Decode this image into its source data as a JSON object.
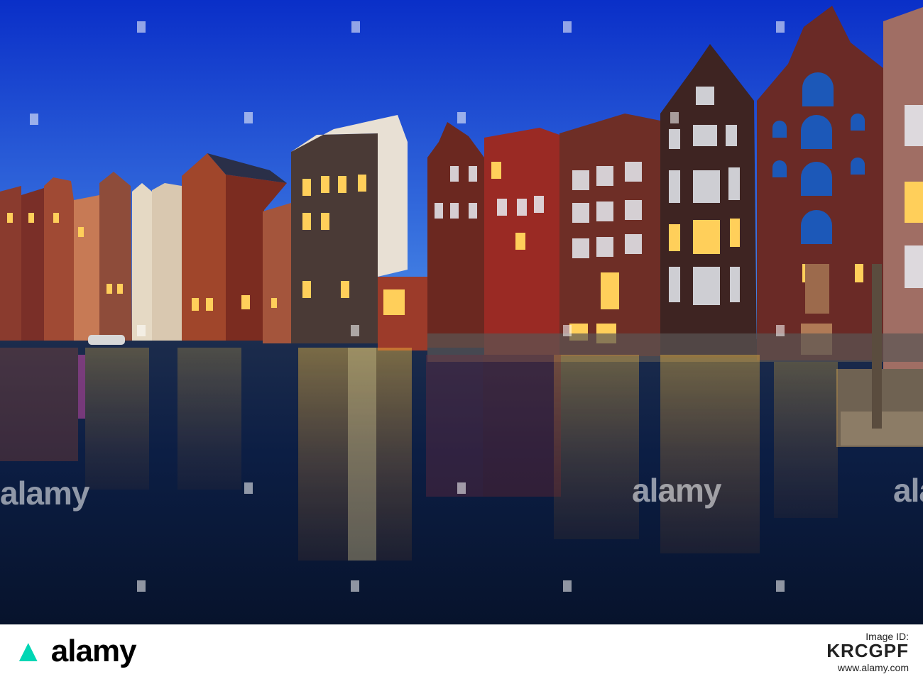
{
  "watermark": {
    "text": "alamy"
  },
  "footer": {
    "logo_text": "alamy",
    "image_id_label": "Image ID:",
    "image_id": "KRCGPF",
    "site": "www.alamy.com"
  },
  "colors": {
    "sky_top": "#0a2fc8",
    "sky_bottom": "#4d8fe8",
    "water": "#0c1e44",
    "logo_accent": "#00d6b4"
  }
}
